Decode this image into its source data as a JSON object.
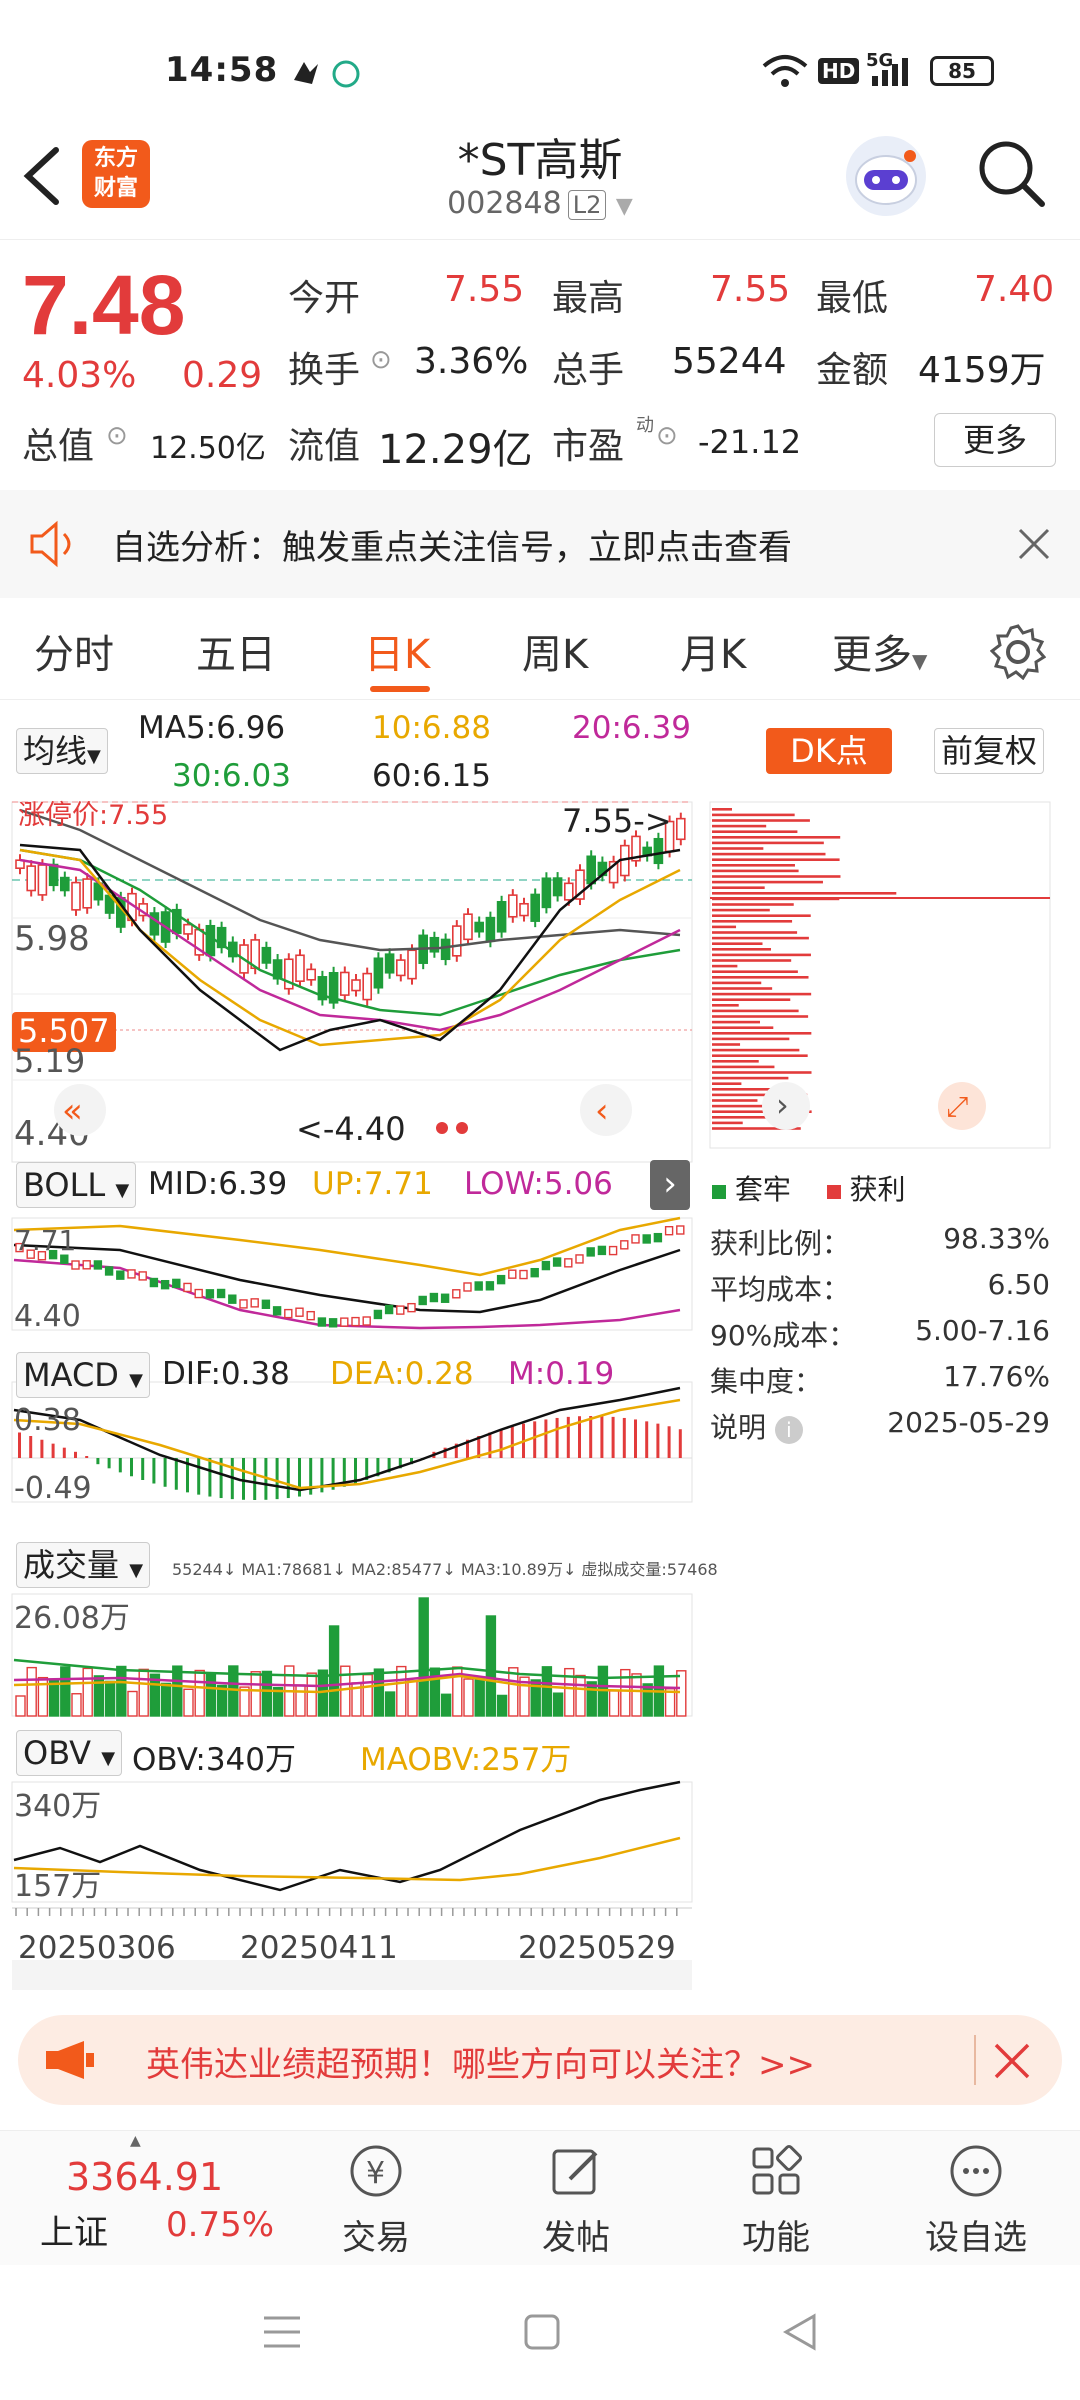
{
  "status_bar": {
    "time": "14:58",
    "battery": "85",
    "network": "5G",
    "hd": "HD"
  },
  "header": {
    "logo_line1": "东方",
    "logo_line2": "财富",
    "stock_name": "*ST高斯",
    "stock_code": "002848",
    "level": "L2"
  },
  "quote": {
    "price": "7.48",
    "change_pct": "4.03%",
    "change_amt": "0.29",
    "open_label": "今开",
    "open": "7.55",
    "high_label": "最高",
    "high": "7.55",
    "low_label": "最低",
    "low": "7.40",
    "turnover_label": "换手",
    "turnover": "3.36%",
    "volume_label": "总手",
    "volume": "55244",
    "amount_label": "金额",
    "amount": "4159万",
    "mktcap_label": "总值",
    "mktcap": "12.50亿",
    "float_label": "流值",
    "float_cap": "12.29亿",
    "pe_label": "市盈",
    "pe_sup": "动",
    "pe": "-21.12",
    "more_label": "更多"
  },
  "notice": {
    "text": "自选分析：触发重点关注信号，立即点击查看"
  },
  "tabs": [
    "分时",
    "五日",
    "日K",
    "周K",
    "月K",
    "更多"
  ],
  "active_tab": "日K",
  "ma_row": {
    "selector": "均线",
    "ma5": "MA5:6.96",
    "ma10": "10:6.88",
    "ma20": "20:6.39",
    "ma30": "30:6.03",
    "ma60": "60:6.15",
    "dk_label": "DK点",
    "adj_label": "前复权"
  },
  "kline": {
    "limit_label": "涨停价:7.55",
    "price_598": "5.98",
    "price_cursor": "5.507",
    "price_519": "5.19",
    "price_440": "4.40",
    "high_marker": "7.55->",
    "low_marker": "<-4.40"
  },
  "boll": {
    "selector": "BOLL",
    "mid": "MID:6.39",
    "up": "UP:7.71",
    "low": "LOW:5.06",
    "top_val": "7.71",
    "bottom_val": "4.40"
  },
  "macd": {
    "selector": "MACD",
    "dif": "DIF:0.38",
    "dea": "DEA:0.28",
    "m": "M:0.19",
    "top_val": "0.38",
    "bottom_val": "-0.49"
  },
  "vol": {
    "selector": "成交量",
    "detail": "55244↓ MA1:78681↓ MA2:85477↓ MA3:10.89万↓ 虚拟成交量:57468",
    "top_val": "26.08万"
  },
  "obv": {
    "selector": "OBV",
    "obv": "OBV:340万",
    "maobv": "MAOBV:257万",
    "top_val": "340万",
    "bottom_val": "157万"
  },
  "dates": [
    "20250306",
    "20250411",
    "20250529"
  ],
  "distribution": {
    "legend_trapped": "套牢",
    "legend_profit": "获利",
    "rows": [
      {
        "k": "获利比例：",
        "v": "98.33%"
      },
      {
        "k": "平均成本：",
        "v": "6.50"
      },
      {
        "k": "90%成本：",
        "v": "5.00-7.16"
      },
      {
        "k": "集中度：",
        "v": "17.76%"
      }
    ],
    "note_label": "说明",
    "date": "2025-05-29"
  },
  "ad": {
    "text": "英伟达业绩超预期！哪些方向可以关注？>>"
  },
  "bottom_nav": {
    "index_value": "3364.91",
    "index_name": "上证",
    "index_change": "0.75%",
    "items": [
      "交易",
      "发帖",
      "功能",
      "设自选"
    ]
  },
  "colors": {
    "up": "#e23b3b",
    "down": "#1f9d3a",
    "brand": "#f25a1b",
    "ma10": "#e8a800",
    "ma20": "#c0299a"
  }
}
